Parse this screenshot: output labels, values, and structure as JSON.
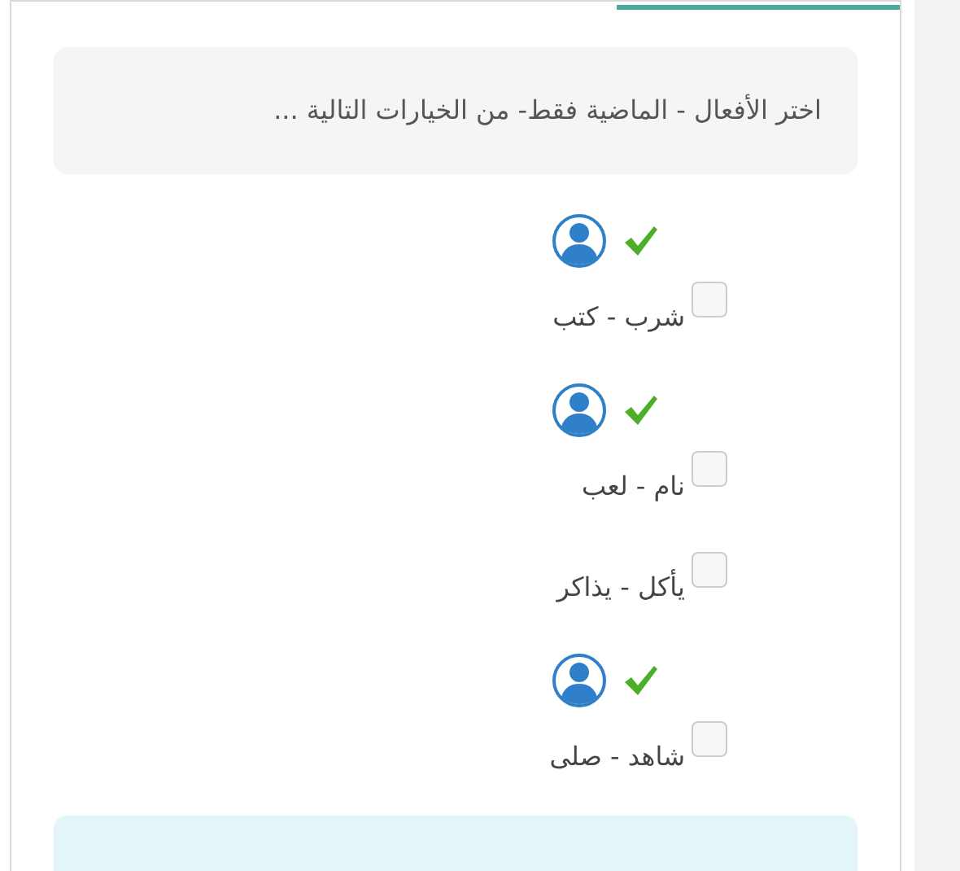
{
  "question": "اختر الأفعال - الماضية فقط- من الخيارات التالية ...",
  "options": [
    {
      "label": "شرب - كتب",
      "checked": false,
      "marked": true
    },
    {
      "label": "نام - لعب",
      "checked": false,
      "marked": true
    },
    {
      "label": "يأكل - يذاكر",
      "checked": false,
      "marked": false
    },
    {
      "label": "شاهد - صلى",
      "checked": false,
      "marked": true
    }
  ]
}
